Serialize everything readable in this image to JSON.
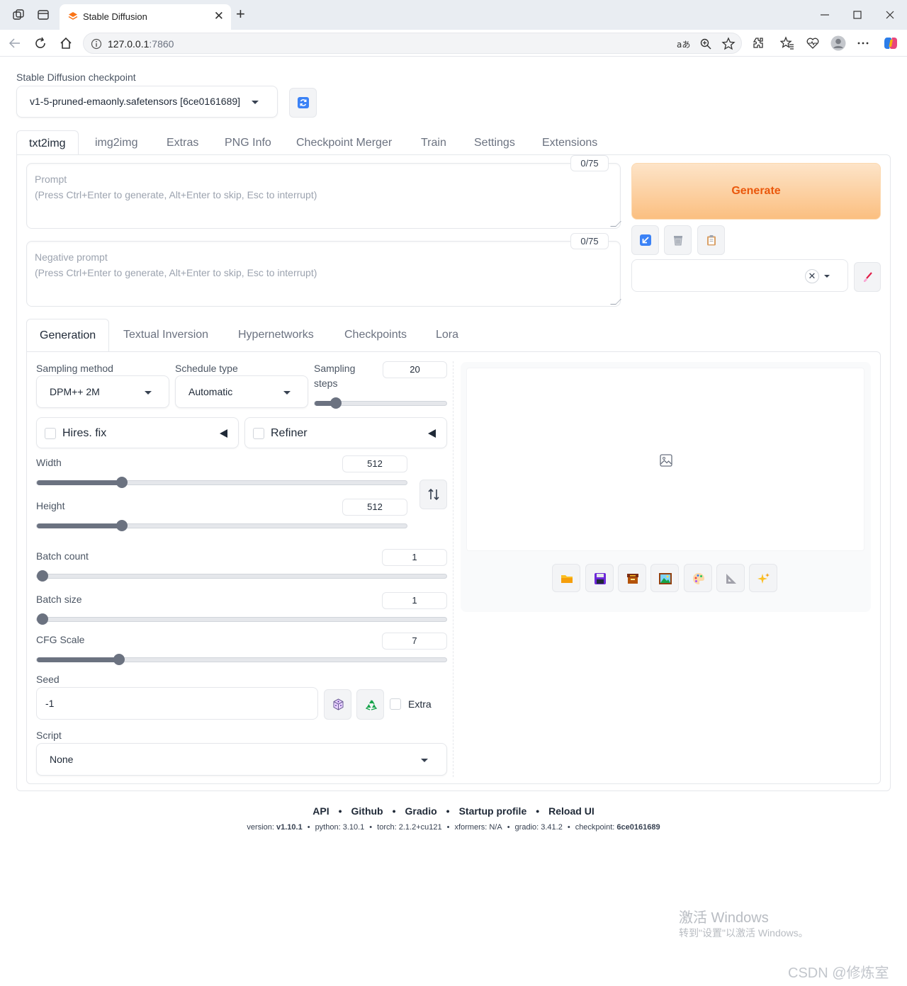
{
  "browser": {
    "tab_title": "Stable Diffusion",
    "url_host": "127.0.0.1",
    "url_port": ":7860",
    "new_tab": "+",
    "close": "✕"
  },
  "checkpoint": {
    "label": "Stable Diffusion checkpoint",
    "value": "v1-5-pruned-emaonly.safetensors [6ce0161689]"
  },
  "main_tabs": [
    "txt2img",
    "img2img",
    "Extras",
    "PNG Info",
    "Checkpoint Merger",
    "Train",
    "Settings",
    "Extensions"
  ],
  "prompt": {
    "label": "Prompt",
    "hint": "(Press Ctrl+Enter to generate, Alt+Enter to skip, Esc to interrupt)",
    "counter": "0/75"
  },
  "negative_prompt": {
    "label": "Negative prompt",
    "hint": "(Press Ctrl+Enter to generate, Alt+Enter to skip, Esc to interrupt)",
    "counter": "0/75"
  },
  "generate_label": "Generate",
  "sub_tabs": [
    "Generation",
    "Textual Inversion",
    "Hypernetworks",
    "Checkpoints",
    "Lora"
  ],
  "sampling": {
    "method_label": "Sampling method",
    "method_value": "DPM++ 2M",
    "schedule_label": "Schedule type",
    "schedule_value": "Automatic",
    "steps_label_1": "Sampling",
    "steps_label_2": "steps",
    "steps_value": "20",
    "steps_fraction": 0.16
  },
  "hires": {
    "label": "Hires. fix"
  },
  "refiner": {
    "label": "Refiner"
  },
  "width": {
    "label": "Width",
    "value": "512",
    "fraction": 0.23
  },
  "height": {
    "label": "Height",
    "value": "512",
    "fraction": 0.23
  },
  "batch_count": {
    "label": "Batch count",
    "value": "1",
    "fraction": 0.0
  },
  "batch_size": {
    "label": "Batch size",
    "value": "1",
    "fraction": 0.0
  },
  "cfg_scale": {
    "label": "CFG Scale",
    "value": "7",
    "fraction": 0.2
  },
  "seed": {
    "label": "Seed",
    "value": "-1",
    "extra_label": "Extra"
  },
  "script": {
    "label": "Script",
    "value": "None"
  },
  "footer": {
    "links": [
      "API",
      "Github",
      "Gradio",
      "Startup profile",
      "Reload UI"
    ],
    "version_label": "version:",
    "version": "v1.10.1",
    "python": "python: 3.10.1",
    "torch": "torch: 2.1.2+cu121",
    "xformers": "xformers: N/A",
    "gradio": "gradio: 3.41.2",
    "checkpoint_label": "checkpoint:",
    "checkpoint": "6ce0161689"
  },
  "watermark": {
    "line1": "激活 Windows",
    "line2": "转到\"设置\"以激活 Windows。",
    "csdn": "CSDN @修炼室"
  },
  "colors": {
    "accent": "#ea580c",
    "generate_bg": "#fbbf80"
  }
}
